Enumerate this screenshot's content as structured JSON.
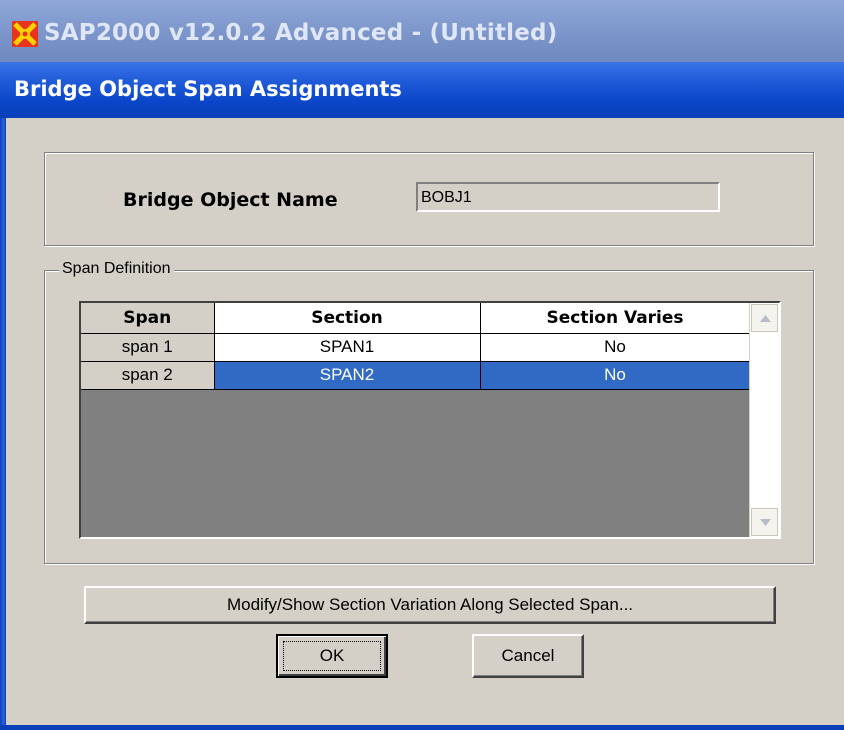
{
  "app": {
    "title": "SAP2000 v12.0.2 Advanced  - (Untitled)",
    "icon": "sap2000-logo-icon"
  },
  "dialog": {
    "title": "Bridge Object Span Assignments",
    "name_label": "Bridge Object Name",
    "name_value": "BOBJ1",
    "span_group_label": "Span Definition",
    "grid": {
      "headers": [
        "Span",
        "Section",
        "Section Varies"
      ],
      "rows": [
        {
          "span": "span 1",
          "section": "SPAN1",
          "varies": "No",
          "selected": false
        },
        {
          "span": "span 2",
          "section": "SPAN2",
          "varies": "No",
          "selected": true
        }
      ]
    },
    "buttons": {
      "modify": "Modify/Show Section Variation Along Selected Span...",
      "ok": "OK",
      "cancel": "Cancel"
    }
  },
  "colors": {
    "dialog_title_bar": "#0a46c9",
    "app_title_bar": "#7d97cc",
    "selection": "#316ac5",
    "dialog_background": "#d4d0c8",
    "grid_background": "#808080"
  }
}
